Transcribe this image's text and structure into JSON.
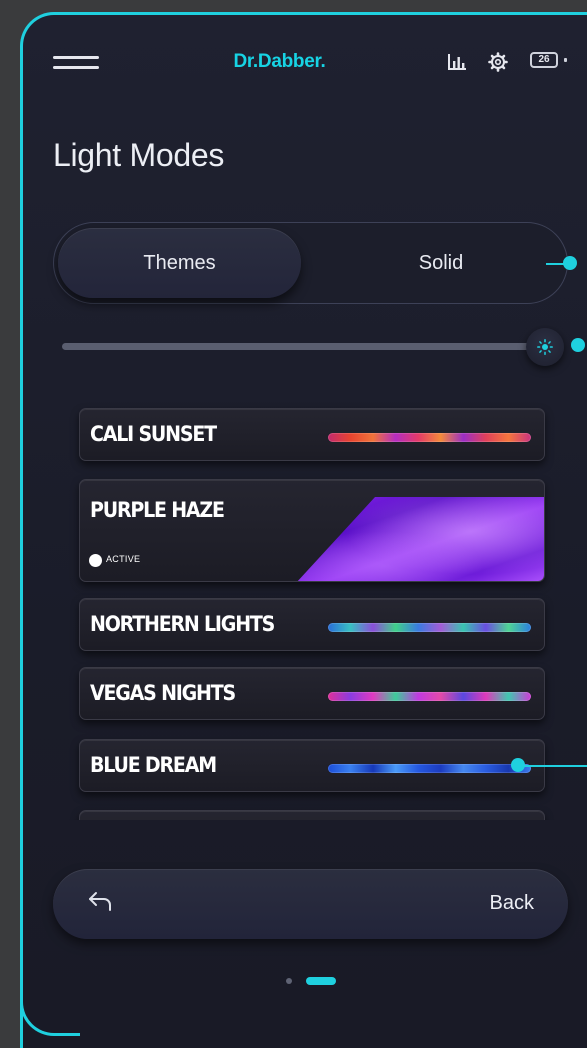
{
  "header": {
    "logo_text": "Dr.Dabber.",
    "battery_level": "26",
    "icons": [
      "menu-icon",
      "bar-chart-icon",
      "gear-icon",
      "battery-icon"
    ]
  },
  "page_title": "Light Modes",
  "tabs": {
    "items": [
      "Themes",
      "Solid"
    ],
    "selected": "Themes"
  },
  "brightness": {
    "level": 1.0
  },
  "themes": {
    "items": [
      {
        "name": "CALI SUNSET"
      },
      {
        "name": "PURPLE HAZE",
        "status": "ACTIVE"
      },
      {
        "name": "NORTHERN LIGHTS"
      },
      {
        "name": "VEGAS NIGHTS"
      },
      {
        "name": "BLUE DREAM"
      }
    ],
    "active": "PURPLE HAZE"
  },
  "back": {
    "label": "Back"
  },
  "pagination": {
    "pages": 2,
    "current": 2
  },
  "colors": {
    "accent": "#1fd0df",
    "background": "#1a1c29",
    "card": "#23232d",
    "outer": "#3a3b3d"
  }
}
